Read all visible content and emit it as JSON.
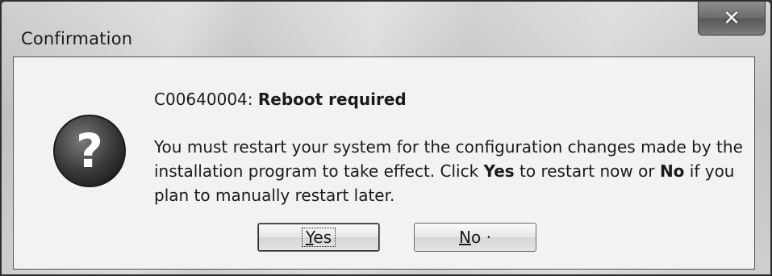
{
  "window": {
    "title": "Confirmation",
    "close_glyph": "✕"
  },
  "dialog": {
    "icon": "question-icon",
    "icon_glyph": "?",
    "code": "C00640004:",
    "heading": "Reboot required",
    "message": {
      "part1": "You must restart your system for the configuration changes made by the installation program to take effect. Click ",
      "yes_word": "Yes",
      "part2": " to restart now or ",
      "no_word": "No",
      "part3": " if you plan to manually restart later."
    }
  },
  "buttons": {
    "yes": {
      "mnemonic": "Y",
      "rest": "es"
    },
    "no": {
      "mnemonic": "N",
      "rest": "o ·"
    }
  }
}
